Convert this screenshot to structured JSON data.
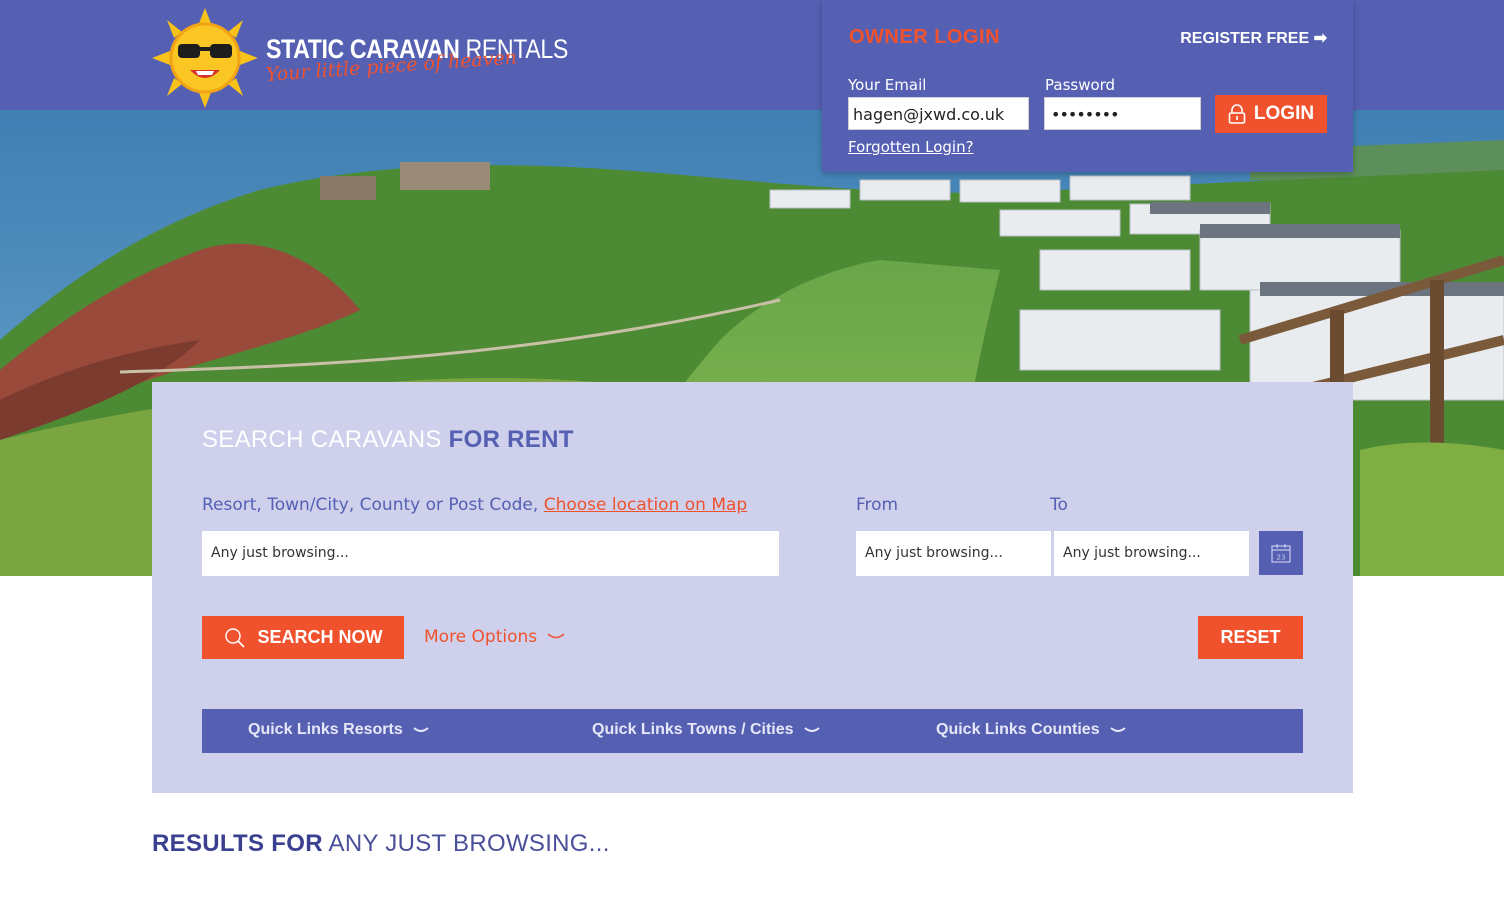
{
  "colors": {
    "brand": "#5560b3",
    "accent": "#f0522d",
    "panel": "#ced0ec"
  },
  "logo": {
    "title_part1": "STATIC CARAVAN",
    "title_part2": "RENTALS",
    "tagline": "Your little piece of heaven"
  },
  "login": {
    "heading": "OWNER LOGIN",
    "register_label": "REGISTER FREE ➡",
    "email_label": "Your Email",
    "email_value": "hagen@jxwd.co.uk",
    "password_label": "Password",
    "password_value": "••••••••",
    "login_button": "LOGIN",
    "forgot_link": "Forgotten Login?",
    "icons": {
      "lock": "lock-icon"
    }
  },
  "search": {
    "title_light": "SEARCH CARAVANS",
    "title_bold": "FOR RENT",
    "location_label": "Resort, Town/City, County or Post Code,",
    "map_link": "Choose location on Map",
    "location_value": "Any just browsing...",
    "from_label": "From",
    "to_label": "To",
    "from_value": "Any just browsing...",
    "to_value": "Any just browsing...",
    "calendar_day": "23",
    "search_button": "SEARCH NOW",
    "more_options": "More Options",
    "reset_button": "RESET",
    "icons": {
      "search": "search-icon",
      "calendar": "calendar-icon",
      "chevron": "chevron-down-icon"
    }
  },
  "quick_links": [
    {
      "label": "Quick Links Resorts"
    },
    {
      "label": "Quick Links Towns / Cities"
    },
    {
      "label": "Quick Links Counties"
    }
  ],
  "results": {
    "prefix": "RESULTS FOR",
    "query": "ANY JUST BROWSING..."
  }
}
